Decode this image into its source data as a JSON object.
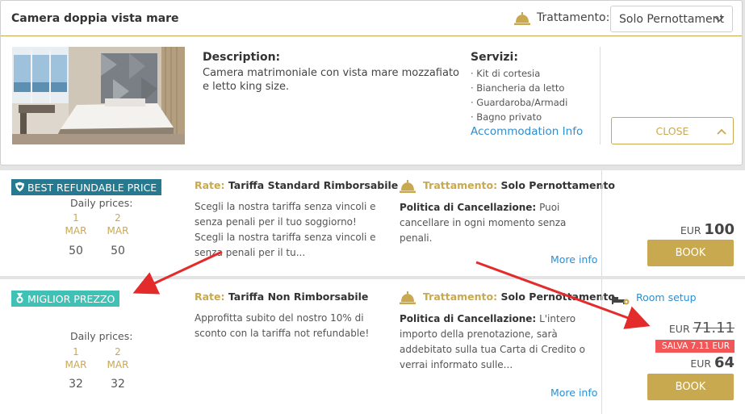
{
  "room": {
    "title": "Camera doppia vista mare",
    "treatment_label": "Trattamento:",
    "treatment_selected": "Solo Pernottament",
    "description_heading": "Description:",
    "description_text": "Camera matrimoniale con vista mare mozzafiato e letto king size.",
    "services_heading": "Servizi:",
    "services": [
      "· Kit di cortesia",
      "· Biancheria da letto",
      "· Guardaroba/Armadi",
      "· Bagno privato"
    ],
    "accommodation_link": "Accommodation Info",
    "close_label": "CLOSE"
  },
  "rates": [
    {
      "badge": "BEST REFUNDABLE PRICE",
      "daily_heading": "Daily prices:",
      "days": [
        {
          "day": "1",
          "month": "MAR",
          "price": "50"
        },
        {
          "day": "2",
          "month": "MAR",
          "price": "50"
        }
      ],
      "rate_label": "Rate:",
      "rate_name": "Tariffa Standard Rimborsabile",
      "rate_description": "Scegli la nostra tariffa senza vincoli e senza penali per il tuo soggiorno! Scegli la nostra tariffa senza vincoli e senza penali per il tu...",
      "treatment_label": "Trattamento:",
      "treatment_value": "Solo Pernottamento",
      "policy_label": "Politica di Cancellazione:",
      "policy_text": "Puoi cancellare in ogni momento senza penali.",
      "more_info": "More info",
      "currency": "EUR",
      "price": "100",
      "book_label": "BOOK"
    },
    {
      "badge": "MIGLIOR PREZZO",
      "daily_heading": "Daily prices:",
      "days": [
        {
          "day": "1",
          "month": "MAR",
          "price": "32"
        },
        {
          "day": "2",
          "month": "MAR",
          "price": "32"
        }
      ],
      "rate_label": "Rate:",
      "rate_name": "Tariffa Non Rimborsabile",
      "rate_description": "Approfitta subito del nostro 10% di sconto con la tariffa not refundable!",
      "treatment_label": "Trattamento:",
      "treatment_value": "Solo Pernottamento",
      "policy_label": "Politica di Cancellazione:",
      "policy_text": "L'intero importo della prenotazione, sarà addebitato sulla tua Carta di Credito o verrai informato sulle...",
      "more_info": "More info",
      "room_setup": "Room setup",
      "currency": "EUR",
      "old_price": "71.11",
      "save_label": "SALVA 7.11 EUR",
      "price": "64",
      "book_label": "BOOK"
    }
  ],
  "colors": {
    "gold": "#c9a94f",
    "link": "#2d8fd0",
    "badge_refundable": "#257a8f",
    "badge_best": "#3fc1b6",
    "save": "#f35656",
    "annotation_arrow": "#e32b2b"
  }
}
